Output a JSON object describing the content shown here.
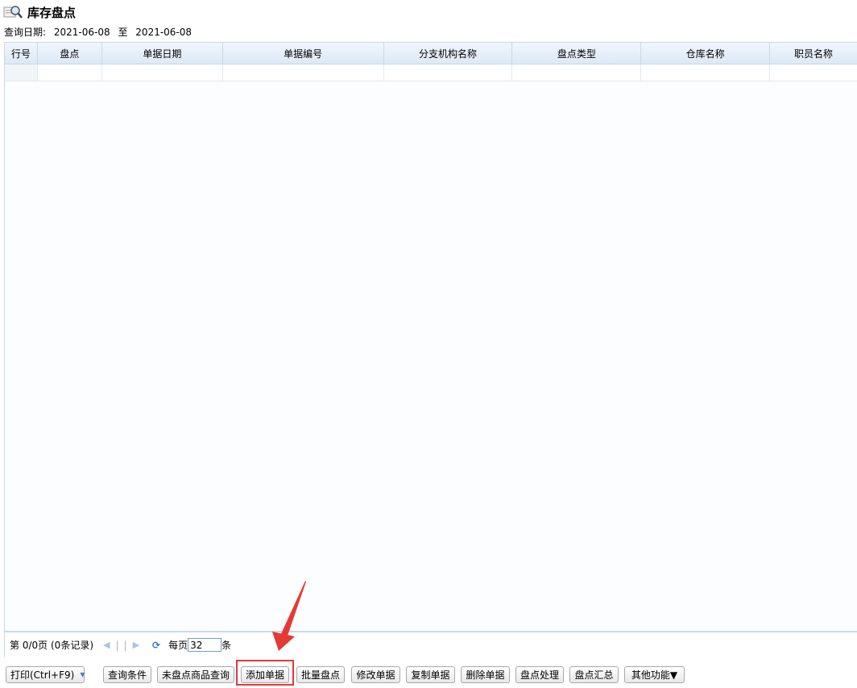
{
  "title": "库存盘点",
  "query": {
    "label": "查询日期:",
    "start": "2021-06-08",
    "to": "至",
    "end": "2021-06-08"
  },
  "columns": [
    "行号",
    "盘点",
    "单据日期",
    "单据编号",
    "分支机构名称",
    "盘点类型",
    "仓库名称",
    "职员名称"
  ],
  "pager": {
    "page_label": "第",
    "page_value": "0/0",
    "page_unit": "页",
    "records": "(0条记录)",
    "per_page_label": "每页",
    "per_page_value": "32",
    "per_page_unit": "条"
  },
  "buttons": {
    "print": "打印(Ctrl+F9)",
    "query_conditions": "查询条件",
    "unchecked_goods": "未盘点商品查询",
    "add_document": "添加单据",
    "batch_check": "批量盘点",
    "edit_document": "修改单据",
    "copy_document": "复制单据",
    "delete_document": "删除单据",
    "check_process": "盘点处理",
    "check_summary": "盘点汇总",
    "other_functions": "其他功能▼"
  },
  "colors": {
    "highlight": "#e53935",
    "header_bg": "#dde9f5",
    "border": "#c8d8e8"
  }
}
